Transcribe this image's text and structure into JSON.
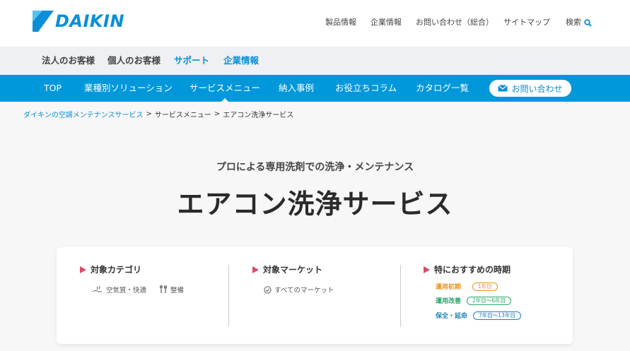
{
  "header": {
    "logo_text": "DAIKIN",
    "links": [
      "製品情報",
      "企業情報",
      "お問い合わせ（総合）",
      "サイトマップ"
    ],
    "search_label": "検索"
  },
  "secondary_nav": [
    "法人のお客様",
    "個人のお客様",
    "サポート",
    "企業情報"
  ],
  "main_nav": [
    "TOP",
    "業種別ソリューション",
    "サービスメニュー",
    "納入事例",
    "お役立ちコラム",
    "カタログ一覧"
  ],
  "contact_button": "お問い合わせ",
  "breadcrumb": {
    "home": "ダイキンの空調メンテナンスサービス",
    "sep": ">",
    "level2": "サービスメニュー",
    "current": "エアコン洗浄サービス"
  },
  "hero": {
    "subtitle": "プロによる専用洗剤での洗浄・メンテナンス",
    "title": "エアコン洗浄サービス"
  },
  "card": {
    "category_head": "対象カテゴリ",
    "category_tags": [
      "空気質・快適",
      "整備"
    ],
    "market_head": "対象マーケット",
    "market_tags": [
      "すべてのマーケット"
    ],
    "timing_head": "特におすすめの時期",
    "timing": [
      {
        "label": "運用初期",
        "period": "1年目",
        "color": "#e8951c"
      },
      {
        "label": "運用改善",
        "period": "2年目～6年目",
        "color": "#2aa56a"
      },
      {
        "label": "保全・延命",
        "period": "7年目～13年目",
        "color": "#1f7fb8"
      }
    ]
  },
  "colors": {
    "brand_blue": "#0098db",
    "accent_red": "#e0486a"
  }
}
